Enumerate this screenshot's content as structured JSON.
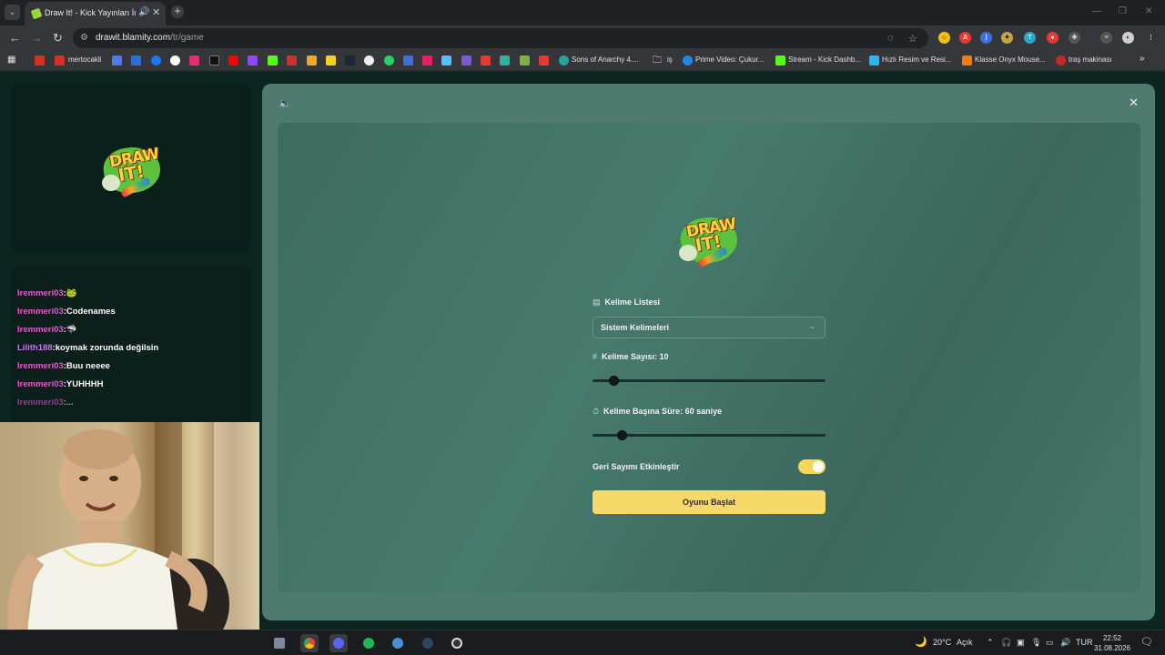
{
  "browser": {
    "tab": {
      "title": "Draw It! - Kick Yayınları İçin",
      "audio_icon": "speaker-icon",
      "close": "✕"
    },
    "new_tab": "+",
    "url": {
      "host": "drawit.blamity.com",
      "path": "/tr/game"
    },
    "bookmarks": [
      {
        "label": "mertocakli"
      },
      {
        "label": "Sons of Anarchy 4...."
      },
      {
        "label": "iş"
      },
      {
        "label": "Prime Video: Çukur..."
      },
      {
        "label": "Stream - Kick Dashb..."
      },
      {
        "label": "Hızlı Resim ve Resi..."
      },
      {
        "label": "Klasse Onyx Mouse..."
      },
      {
        "label": "traş makinası"
      }
    ]
  },
  "chat": {
    "messages": [
      {
        "user": "Iremmeri03",
        "text": "🐸"
      },
      {
        "user": "Iremmeri03",
        "text": "Codenames"
      },
      {
        "user": "Iremmeri03",
        "text": "🦈"
      },
      {
        "user": "Lilith188",
        "text": "koymak zorunda değilsin"
      },
      {
        "user": "Iremmeri03",
        "text": "Buu neeee"
      },
      {
        "user": "Iremmeri03",
        "text": "YUHHHH"
      },
      {
        "user": "Iremmeri03",
        "text": "..."
      }
    ]
  },
  "logo": {
    "line1": "DRAW",
    "line2": "IT!"
  },
  "settings": {
    "word_list_label": "Kelime Listesi",
    "word_list_value": "Sistem Kelimeleri",
    "word_count_label": "Kelime Sayısı: 10",
    "word_count_fraction": 0.09,
    "time_label": "Kelime Başına Süre: 60 saniye",
    "time_fraction": 0.125,
    "countdown_label": "Geri Sayımı Etkinleştir",
    "countdown_enabled": true,
    "start_button": "Oyunu Başlat"
  },
  "taskbar": {
    "weather": "20°C",
    "weather_desc": "Açık",
    "lang": "TUR",
    "time": "22:52",
    "date": "31.08.2026"
  },
  "colors": {
    "accent": "#f7d96a",
    "chat_user": "#e05bd0",
    "modal_bg": "#4f7a6e"
  }
}
